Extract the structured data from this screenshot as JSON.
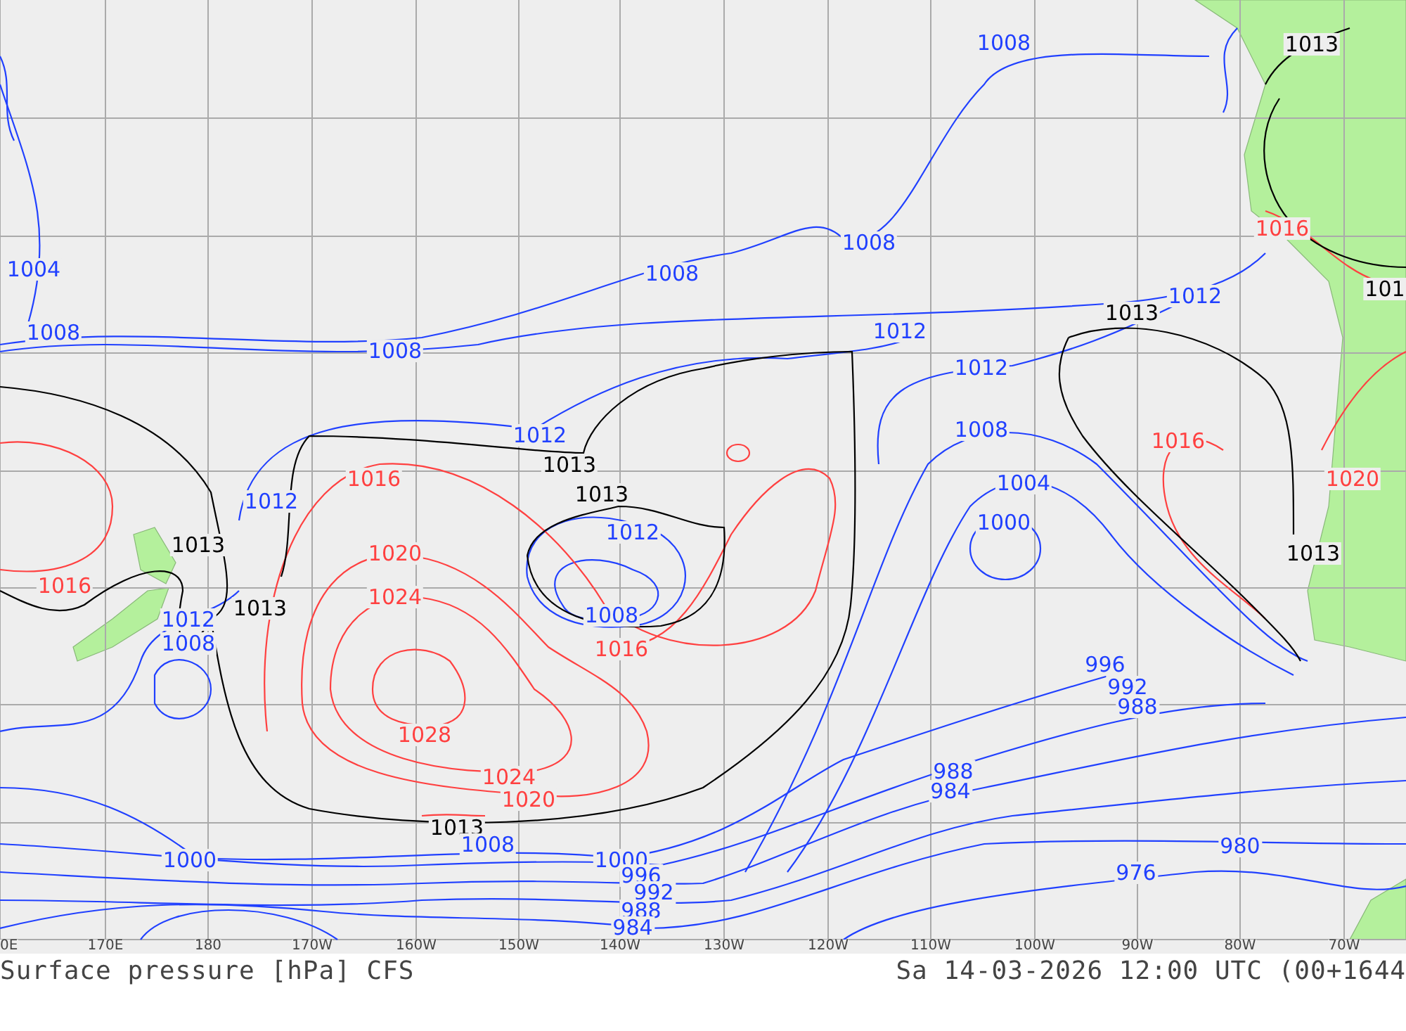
{
  "map": {
    "axis_labels": [
      "0E",
      "170E",
      "180",
      "170W",
      "160W",
      "150W",
      "140W",
      "130W",
      "120W",
      "110W",
      "100W",
      "90W",
      "80W",
      "70W"
    ],
    "isobar_labels": [
      {
        "text": "1008",
        "color": "#2040ff"
      },
      {
        "text": "1013",
        "color": "#000000"
      },
      {
        "text": "1004",
        "color": "#2040ff"
      },
      {
        "text": "1008",
        "color": "#2040ff"
      },
      {
        "text": "1008",
        "color": "#2040ff"
      },
      {
        "text": "1016",
        "color": "#ff4040"
      },
      {
        "text": "101",
        "color": "#000000"
      },
      {
        "text": "1008",
        "color": "#2040ff"
      },
      {
        "text": "1008",
        "color": "#2040ff"
      },
      {
        "text": "1012",
        "color": "#2040ff"
      },
      {
        "text": "1013",
        "color": "#000000"
      },
      {
        "text": "1012",
        "color": "#2040ff"
      },
      {
        "text": "1012",
        "color": "#2040ff"
      },
      {
        "text": "1012",
        "color": "#2040ff"
      },
      {
        "text": "1013",
        "color": "#000000"
      },
      {
        "text": "1016",
        "color": "#ff4040"
      },
      {
        "text": "1013",
        "color": "#000000"
      },
      {
        "text": "1008",
        "color": "#2040ff"
      },
      {
        "text": "1016",
        "color": "#ff4040"
      },
      {
        "text": "1020",
        "color": "#ff4040"
      },
      {
        "text": "1012",
        "color": "#2040ff"
      },
      {
        "text": "1013",
        "color": "#000000"
      },
      {
        "text": "1004",
        "color": "#2040ff"
      },
      {
        "text": "1012",
        "color": "#2040ff"
      },
      {
        "text": "1000",
        "color": "#2040ff"
      },
      {
        "text": "1020",
        "color": "#ff4040"
      },
      {
        "text": "1013",
        "color": "#000000"
      },
      {
        "text": "1016",
        "color": "#ff4040"
      },
      {
        "text": "1024",
        "color": "#ff4040"
      },
      {
        "text": "1013",
        "color": "#000000"
      },
      {
        "text": "1008",
        "color": "#2040ff"
      },
      {
        "text": "1016",
        "color": "#ff4040"
      },
      {
        "text": "1012",
        "color": "#2040ff"
      },
      {
        "text": "1008",
        "color": "#2040ff"
      },
      {
        "text": "996",
        "color": "#2040ff"
      },
      {
        "text": "992",
        "color": "#2040ff"
      },
      {
        "text": "988",
        "color": "#2040ff"
      },
      {
        "text": "1028",
        "color": "#ff4040"
      },
      {
        "text": "1024",
        "color": "#ff4040"
      },
      {
        "text": "988",
        "color": "#2040ff"
      },
      {
        "text": "984",
        "color": "#2040ff"
      },
      {
        "text": "1020",
        "color": "#ff4040"
      },
      {
        "text": "1013",
        "color": "#000000"
      },
      {
        "text": "1008",
        "color": "#2040ff"
      },
      {
        "text": "1000",
        "color": "#2040ff"
      },
      {
        "text": "1000",
        "color": "#2040ff"
      },
      {
        "text": "980",
        "color": "#2040ff"
      },
      {
        "text": "976",
        "color": "#2040ff"
      },
      {
        "text": "996",
        "color": "#2040ff"
      },
      {
        "text": "992",
        "color": "#2040ff"
      },
      {
        "text": "988",
        "color": "#2040ff"
      },
      {
        "text": "984",
        "color": "#2040ff"
      }
    ]
  },
  "footer": {
    "title": "Surface pressure [hPa] CFS",
    "timestamp": "Sa 14-03-2026 12:00 UTC (00+1644"
  }
}
